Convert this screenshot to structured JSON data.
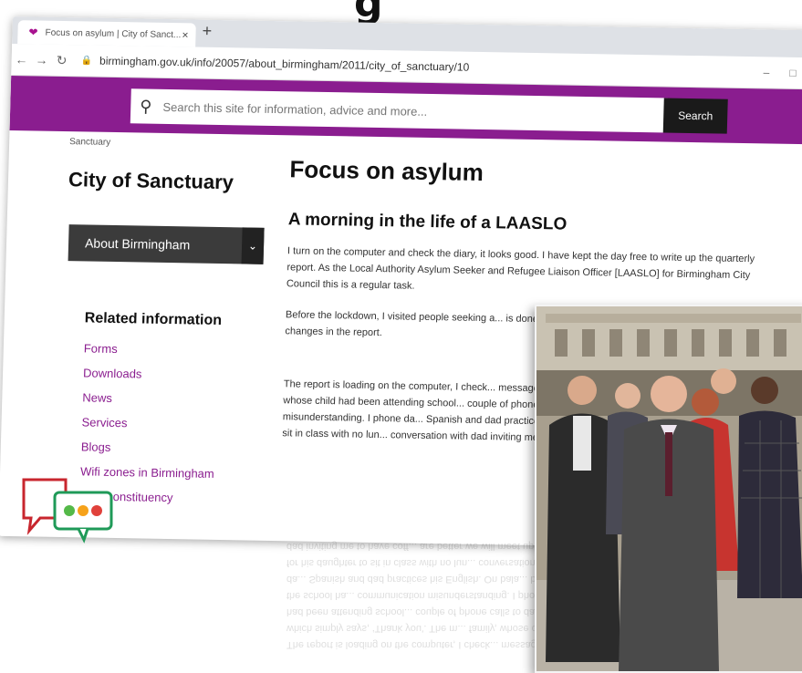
{
  "browser": {
    "tab_title": "Focus on asylum | City of Sanct...",
    "tab_close": "×",
    "new_tab": "+",
    "url": "birmingham.gov.uk/info/20057/about_birmingham/2011/city_of_sanctuary/10",
    "window_min": "–",
    "window_max": "□"
  },
  "header": {
    "search_placeholder": "Search this site for information, advice and more...",
    "search_button": "Search"
  },
  "breadcrumb": "Sanctuary",
  "sidebar": {
    "title": "City of Sanctuary",
    "dropdown_label": "About Birmingham",
    "related_heading": "Related information",
    "links": [
      "Forms",
      "Downloads",
      "News",
      "Services",
      "Blogs",
      "Wifi zones in Birmingham",
      "Your constituency"
    ]
  },
  "main": {
    "title": "Focus on asylum",
    "subtitle": "A morning in the life of a LAASLO",
    "paragraphs": [
      "I turn on the computer and check the diary, it looks good. I have kept the day free to write up the quarterly report. As the Local Authority Asylum Seeker and Refugee Liaison Officer [LAASLO] for Birmingham City Council this is a regular task.",
      "Before the lockdown, I visited people seeking a... is done by phone calls, texts, WhatsApp and em... changes in the report.",
      "The report is loading on the computer, I check... message, which simply says, ‘Thank you’. The m... family, whose child had been attending school... couple of phone calls to dad and the school ha... communication misunderstanding. I phone da... Spanish and dad practices his English. On bala... been for his daughter to sit in class with no lun... conversation with dad inviting me to have coff... are better we will meet up."
    ]
  },
  "colors": {
    "brand_purple": "#8a1d8f",
    "link_purple": "#8a1d8f",
    "search_button_bg": "#1a1a1a",
    "dropdown_bg": "#3b3b3b"
  },
  "photo": {
    "alt": "Group of people standing outdoors in a city square"
  }
}
